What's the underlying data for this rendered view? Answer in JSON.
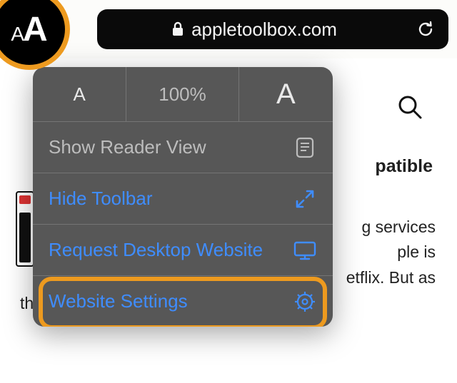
{
  "addressBar": {
    "domain": "appletoolbox.com"
  },
  "popover": {
    "zoom": {
      "decreaseGlyph": "A",
      "percent": "100%",
      "increaseGlyph": "A"
    },
    "readerView": "Show Reader View",
    "hideToolbar": "Hide Toolbar",
    "requestDesktop": "Request Desktop Website",
    "websiteSettings": "Website Settings"
  },
  "page": {
    "titleFragment": "patible",
    "bodyFragmentR1": "g services",
    "bodyFragmentR2": "ple is",
    "bodyFragmentR3": "etflix. But as",
    "bodyLine2": "the world screams"
  }
}
